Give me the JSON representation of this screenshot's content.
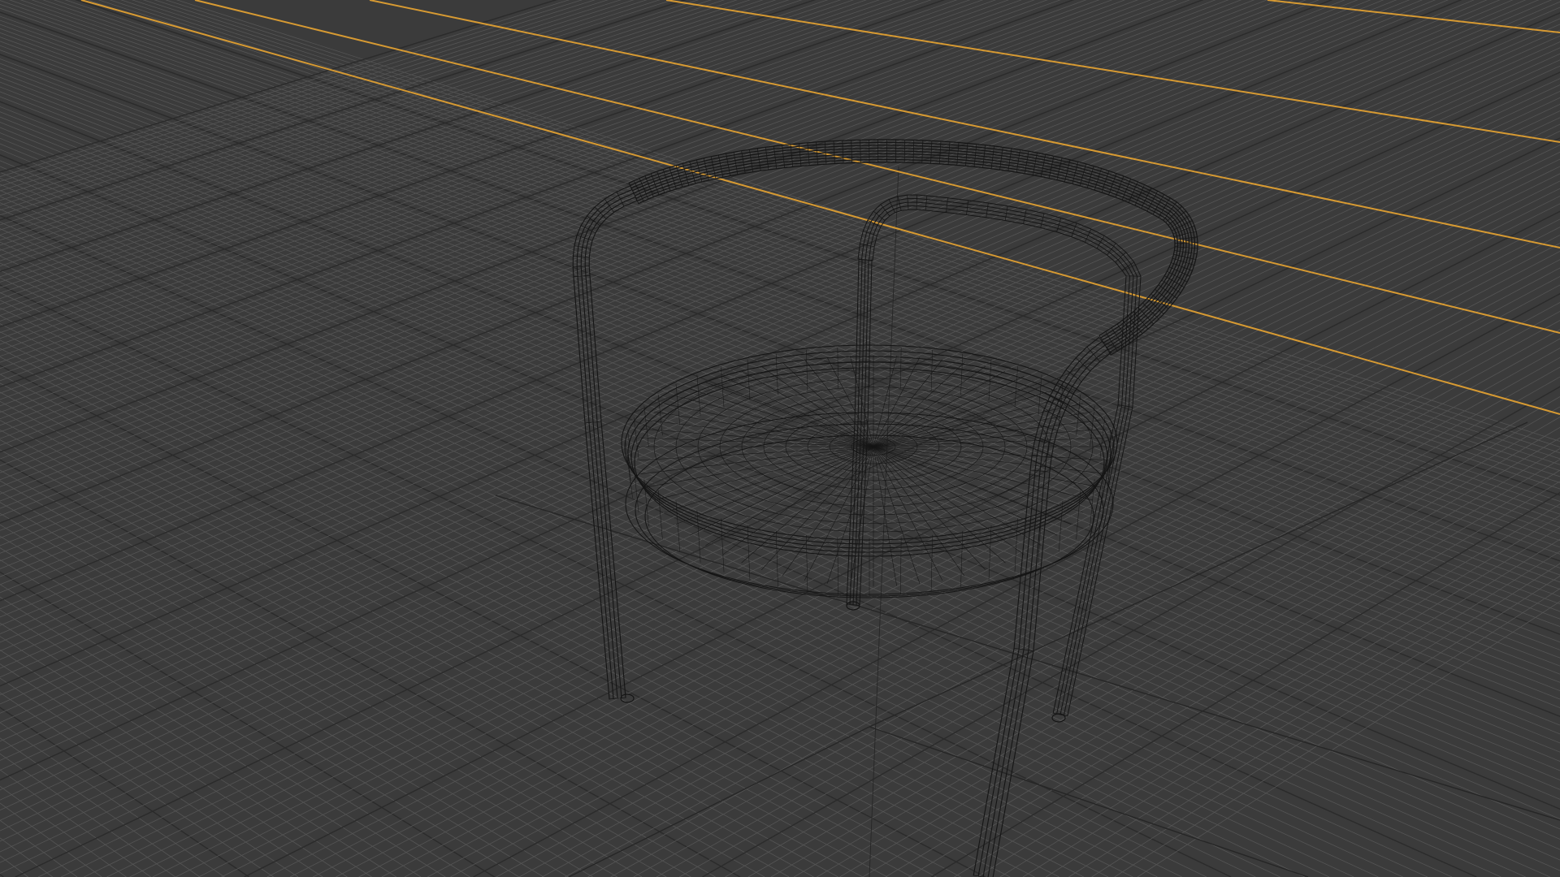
{
  "viewport": {
    "background": "#3b3b3b",
    "grid_color": "#555555",
    "grid_major_color": "#2b2b2b",
    "guide_line_color": "#d79a32",
    "wire_color": "#151515",
    "display_mode": "wireframe"
  },
  "scene": {
    "object": "chair",
    "object_icon": "chair-wireframe-icon"
  }
}
